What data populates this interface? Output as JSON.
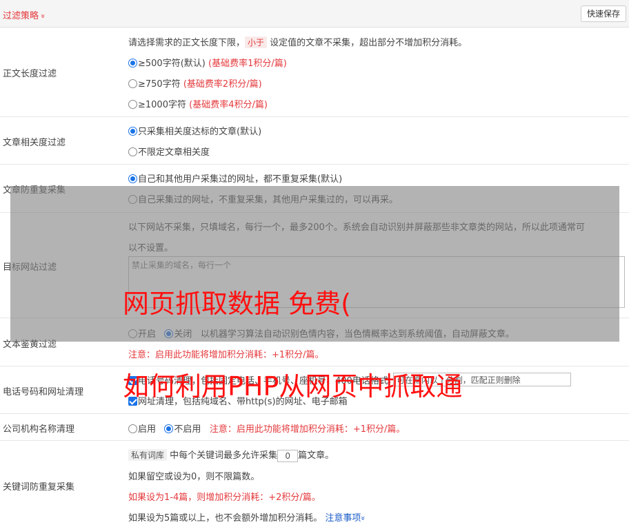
{
  "header": {
    "title": "过滤策略",
    "chevron": "»",
    "save_label": "快速保存"
  },
  "length": {
    "label": "正文长度过滤",
    "desc_pre": "请选择需求的正文长度下限，",
    "desc_tag": "小于",
    "desc_post": "设定值的文章不采集，超出部分不增加积分消耗。",
    "options": [
      {
        "text": "≥500字符(默认)",
        "note": "(基础费率1积分/篇)"
      },
      {
        "text": "≥750字符",
        "note": "(基础费率2积分/篇)"
      },
      {
        "text": "≥1000字符",
        "note": "(基础费率4积分/篇)"
      }
    ]
  },
  "relevance": {
    "label": "文章相关度过滤",
    "options": [
      "只采集相关度达标的文章(默认)",
      "不限定文章相关度"
    ]
  },
  "dedupe": {
    "label": "文章防重复采集",
    "options": [
      "自己和其他用户采集过的网址，都不重复采集(默认)",
      "自己采集过的网址，不重复采集，其他用户采集过的，可以再采。"
    ]
  },
  "target": {
    "label": "目标网站过滤",
    "desc_line1": "以下网站不采集，只填域名，每行一个，最多200个。系统会自动识别并屏蔽那些非文章类的网站，所以此项通常可",
    "desc_line2": "以不设置。",
    "placeholder": "禁止采集的域名，每行一个"
  },
  "porn": {
    "label": "文本鉴黄过滤",
    "on_label": "开启",
    "off_label": "关闭",
    "desc": "以机器学习算法自动识别色情内容，当色情概率达到系统阈值，自动屏蔽文章。",
    "notice": "注意：启用此功能将增加积分消耗：+1积分/篇。"
  },
  "phone": {
    "label": "电话号码和网址清理",
    "line1": "电话号码清理，包括固定电话、手机号、座机号、400电话格式，可在框内以 | 分割，匹配正则删除",
    "input_value": "可在框内以 | 分割，匹配正则删除",
    "line2": "网址清理，包括纯域名、带http(s)的网址、电子邮箱"
  },
  "company": {
    "label": "公司机构名称清理",
    "on_label": "启用",
    "off_label": "不启用",
    "notice": "注意：启用此功能将增加积分消耗：+1积分/篇。"
  },
  "keyword": {
    "label": "关键词防重复采集",
    "tag": "私有词库",
    "line1_pre": "中每个关键词最多允许采集",
    "value": "0",
    "line1_post": "篇文章。",
    "line2": "如果留空或设为0，则不限篇数。",
    "line3": "如果设为1-4篇，则增加积分消耗：+2积分/篇。",
    "line4": "如果设为5篇或以上，也不会额外增加积分消耗。",
    "link": "注意事项",
    "link_chevron": "»"
  },
  "watermark": {
    "line1": "网页抓取数据 免费(",
    "line2": "如何利用PHP从网页中抓取通"
  }
}
